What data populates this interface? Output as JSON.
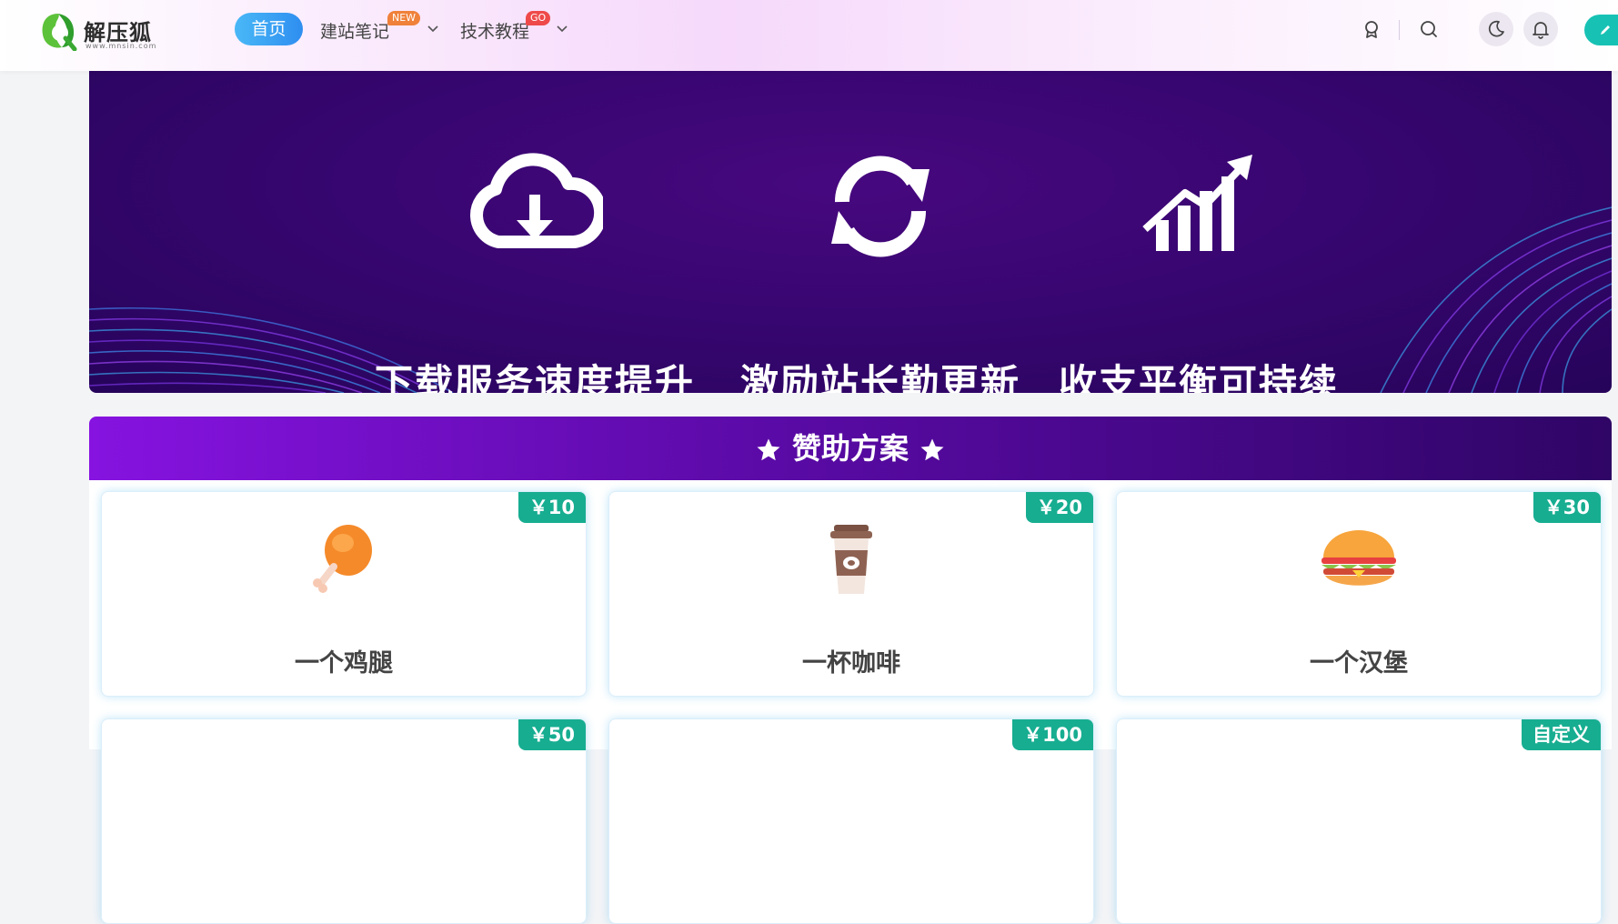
{
  "header": {
    "logo_text": "解压狐",
    "logo_sub": "www.mnsin.com",
    "nav": [
      {
        "label": "首页",
        "active": true
      },
      {
        "label": "建站笔记",
        "badge": "NEW",
        "badge_color": "#f0813a"
      },
      {
        "label": "技术教程",
        "badge": "GO",
        "badge_color": "#ef4a4a"
      }
    ],
    "icons": [
      "medal-icon",
      "search-icon",
      "moon-icon",
      "bell-icon",
      "edit-icon"
    ],
    "accent": "#2f8ef0"
  },
  "banner": {
    "features": [
      {
        "icon": "cloud-download-icon",
        "label": "下载服务速度提升"
      },
      {
        "icon": "refresh-icon",
        "label": "激励站长勤更新"
      },
      {
        "icon": "growth-chart-icon",
        "label": "收支平衡可持续"
      }
    ]
  },
  "sponsor": {
    "title": "赞助方案",
    "plans": [
      {
        "price": "￥10",
        "label": "一个鸡腿",
        "icon": "chicken-leg-icon"
      },
      {
        "price": "￥20",
        "label": "一杯咖啡",
        "icon": "coffee-cup-icon"
      },
      {
        "price": "￥30",
        "label": "一个汉堡",
        "icon": "burger-icon"
      },
      {
        "price": "￥50",
        "label": "",
        "icon": ""
      },
      {
        "price": "￥100",
        "label": "",
        "icon": ""
      },
      {
        "price": "自定义",
        "label": "",
        "icon": ""
      }
    ],
    "price_color": "#17ad91"
  }
}
